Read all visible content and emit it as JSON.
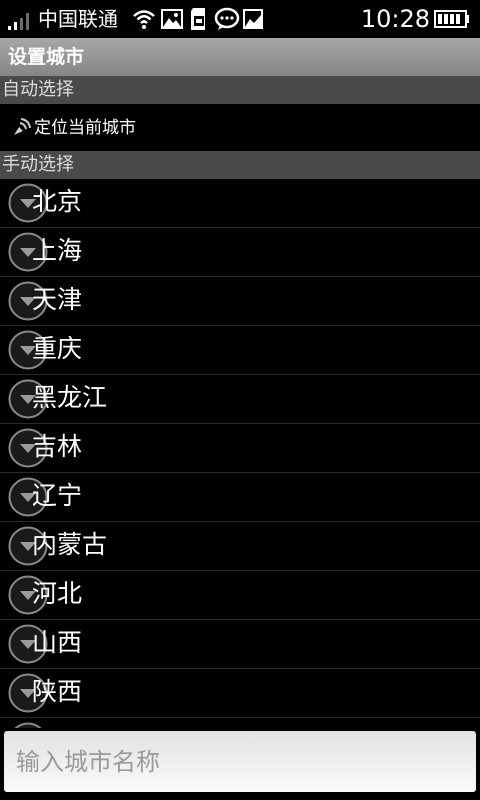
{
  "status_bar": {
    "carrier": "中国联通",
    "time": "10:28",
    "icons": [
      "signal-icon",
      "wifi-icon",
      "image-icon",
      "sd-card-icon",
      "message-icon",
      "photo-icon",
      "battery-icon"
    ]
  },
  "header": {
    "title": "设置城市"
  },
  "auto_section": {
    "header": "自动选择",
    "locate_label": "定位当前城市",
    "locate_icon": "location-icon"
  },
  "manual_section": {
    "header": "手动选择",
    "provinces": [
      "北京",
      "上海",
      "天津",
      "重庆",
      "黑龙江",
      "吉林",
      "辽宁",
      "内蒙古",
      "河北",
      "山西",
      "陕西",
      ""
    ]
  },
  "search": {
    "placeholder": "输入城市名称",
    "value": ""
  },
  "colors": {
    "background": "#000000",
    "title_bar": "#9a9a9a",
    "section_header": "#4a4a4a",
    "text": "#ffffff"
  }
}
